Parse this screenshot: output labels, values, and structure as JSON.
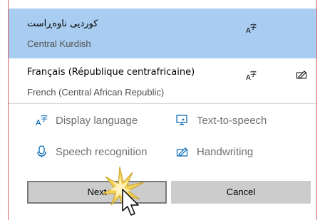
{
  "languages": [
    {
      "title": "کوردیی ناوەڕاست",
      "subtitle": "Central Kurdish",
      "selected": true,
      "capabilities": [
        "display-language"
      ]
    },
    {
      "title": "Français (République centrafricaine)",
      "subtitle": "French (Central African Republic)",
      "selected": false,
      "capabilities": [
        "display-language",
        "handwriting"
      ]
    }
  ],
  "features": {
    "display_language": "Display language",
    "text_to_speech": "Text-to-speech",
    "speech_recognition": "Speech recognition",
    "handwriting": "Handwriting"
  },
  "buttons": {
    "next": "Next",
    "cancel": "Cancel"
  },
  "colors": {
    "selected_row": "#a9cdf0",
    "feature_icon": "#0063b1",
    "border_accent": "#e06060"
  }
}
